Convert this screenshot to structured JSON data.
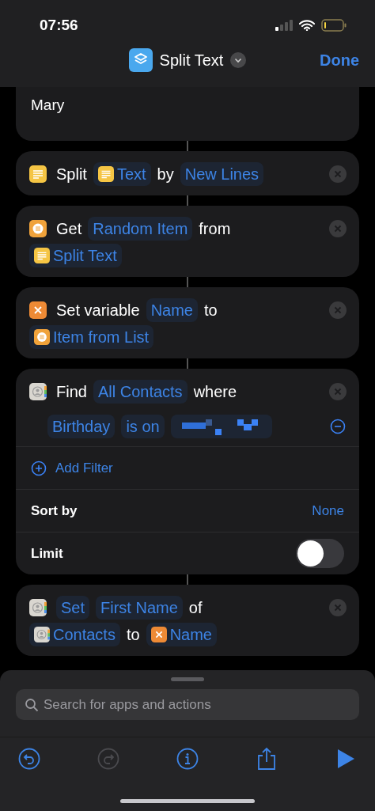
{
  "status_bar": {
    "time": "07:56"
  },
  "nav": {
    "title": "Split Text",
    "done": "Done"
  },
  "actions": [
    {
      "kind": "output",
      "lines": [
        "Mary"
      ]
    },
    {
      "kind": "text-action",
      "rows": [
        [
          {
            "kind": "word",
            "text": "Split"
          },
          {
            "kind": "text-param",
            "text": "Text"
          },
          {
            "kind": "word",
            "text": "by"
          },
          {
            "kind": "param",
            "text": "New Lines"
          }
        ]
      ]
    },
    {
      "kind": "list-action",
      "rows": [
        [
          {
            "kind": "word",
            "text": "Get"
          },
          {
            "kind": "param",
            "text": "Random Item"
          },
          {
            "kind": "word",
            "text": "from"
          }
        ],
        [
          {
            "kind": "text-param",
            "text": "Split Text"
          }
        ]
      ]
    },
    {
      "kind": "variable-action",
      "rows": [
        [
          {
            "kind": "word",
            "text": "Set variable"
          },
          {
            "kind": "param",
            "text": "Name"
          },
          {
            "kind": "word",
            "text": "to"
          }
        ],
        [
          {
            "kind": "list-param",
            "text": "Item from List"
          }
        ]
      ]
    },
    {
      "kind": "contacts-find",
      "rows": [
        [
          {
            "kind": "word",
            "text": "Find"
          },
          {
            "kind": "param",
            "text": "All Contacts"
          },
          {
            "kind": "word",
            "text": "where"
          }
        ]
      ],
      "filter": [
        {
          "kind": "param",
          "text": "Birthday"
        },
        {
          "kind": "param",
          "text": "is on"
        },
        {
          "kind": "redacted"
        }
      ],
      "add_filter": "Add Filter",
      "sort_label": "Sort by",
      "sort_value": "None",
      "limit_label": "Limit",
      "limit_on": false
    },
    {
      "kind": "contacts-action",
      "rows": [
        [
          {
            "kind": "param",
            "text": "Set"
          },
          {
            "kind": "param",
            "text": "First Name"
          },
          {
            "kind": "word",
            "text": "of"
          }
        ],
        [
          {
            "kind": "contacts-param",
            "text": "Contacts"
          },
          {
            "kind": "word",
            "text": "to"
          },
          {
            "kind": "variable-param",
            "text": "Name"
          }
        ]
      ]
    }
  ],
  "search": {
    "placeholder": "Search for apps and actions"
  },
  "toolbar": [
    {
      "kind": "undo",
      "disabled": false
    },
    {
      "kind": "redo",
      "disabled": true
    },
    {
      "kind": "info",
      "disabled": false
    },
    {
      "kind": "share",
      "disabled": false
    },
    {
      "kind": "run",
      "disabled": false
    }
  ]
}
